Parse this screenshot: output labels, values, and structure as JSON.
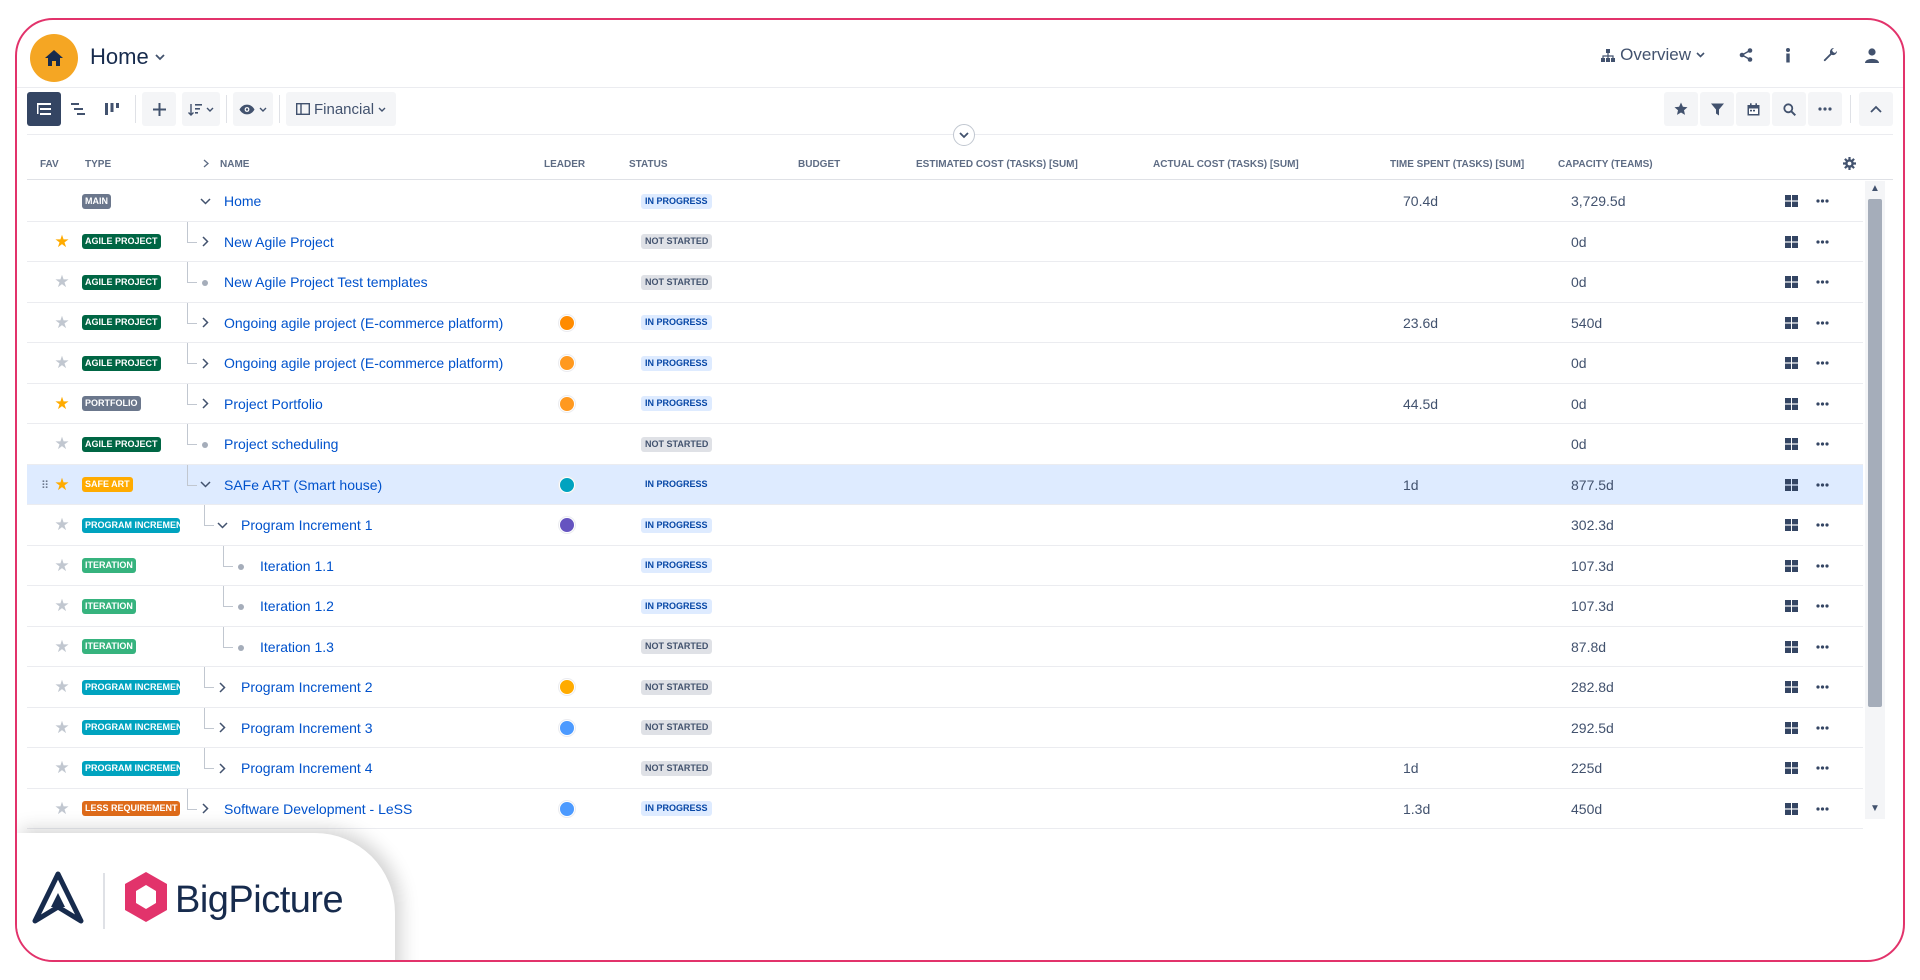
{
  "header": {
    "title": "Home",
    "view_label": "Overview"
  },
  "toolbar": {
    "view_selector_label": "Financial"
  },
  "columns": {
    "fav": "FAV",
    "type": "TYPE",
    "name": "NAME",
    "leader": "LEADER",
    "status": "STATUS",
    "budget": "BUDGET",
    "estimated_cost": "ESTIMATED COST (TASKS) [SUM]",
    "actual_cost": "ACTUAL COST (TASKS) [SUM]",
    "time_spent": "TIME SPENT (TASKS) [SUM]",
    "capacity": "CAPACITY (TEAMS)"
  },
  "rows": [
    {
      "fav": "none",
      "type": "MAIN",
      "type_color": "#6b778c",
      "name": "Home",
      "leader": "",
      "status": "IN PROGRESS",
      "time_spent": "70.4d",
      "capacity": "3,729.5d"
    },
    {
      "fav": "on",
      "type": "AGILE PROJECT",
      "type_color": "#006644",
      "name": "New Agile Project",
      "leader": "",
      "status": "NOT STARTED",
      "time_spent": "",
      "capacity": "0d"
    },
    {
      "fav": "off",
      "type": "AGILE PROJECT",
      "type_color": "#006644",
      "name": "New Agile Project Test templates",
      "leader": "",
      "status": "NOT STARTED",
      "time_spent": "",
      "capacity": "0d"
    },
    {
      "fav": "off",
      "type": "AGILE PROJECT",
      "type_color": "#006644",
      "name": "Ongoing agile project (E-commerce platform)",
      "leader": "#ff8b00",
      "status": "IN PROGRESS",
      "time_spent": "23.6d",
      "capacity": "540d"
    },
    {
      "fav": "off",
      "type": "AGILE PROJECT",
      "type_color": "#006644",
      "name": "Ongoing agile project (E-commerce platform)",
      "leader": "#ff991f",
      "status": "IN PROGRESS",
      "time_spent": "",
      "capacity": "0d"
    },
    {
      "fav": "on",
      "type": "PORTFOLIO",
      "type_color": "#6b778c",
      "name": "Project Portfolio",
      "leader": "#ff991f",
      "status": "IN PROGRESS",
      "time_spent": "44.5d",
      "capacity": "0d"
    },
    {
      "fav": "off",
      "type": "AGILE PROJECT",
      "type_color": "#006644",
      "name": "Project scheduling",
      "leader": "",
      "status": "NOT STARTED",
      "time_spent": "",
      "capacity": "0d"
    },
    {
      "fav": "on",
      "type": "SAFE ART",
      "type_color": "#ffab00",
      "name": "SAFe ART (Smart house)",
      "leader": "#00a3bf",
      "status": "IN PROGRESS",
      "time_spent": "1d",
      "capacity": "877.5d"
    },
    {
      "fav": "off",
      "type": "PROGRAM INCREMENT",
      "type_color": "#00a3bf",
      "name": "Program Increment 1",
      "leader": "#6554c0",
      "status": "IN PROGRESS",
      "time_spent": "",
      "capacity": "302.3d"
    },
    {
      "fav": "off",
      "type": "ITERATION",
      "type_color": "#36b37e",
      "name": "Iteration 1.1",
      "leader": "",
      "status": "IN PROGRESS",
      "time_spent": "",
      "capacity": "107.3d"
    },
    {
      "fav": "off",
      "type": "ITERATION",
      "type_color": "#36b37e",
      "name": "Iteration 1.2",
      "leader": "",
      "status": "IN PROGRESS",
      "time_spent": "",
      "capacity": "107.3d"
    },
    {
      "fav": "off",
      "type": "ITERATION",
      "type_color": "#36b37e",
      "name": "Iteration 1.3",
      "leader": "",
      "status": "NOT STARTED",
      "time_spent": "",
      "capacity": "87.8d"
    },
    {
      "fav": "off",
      "type": "PROGRAM INCREMENT",
      "type_color": "#00a3bf",
      "name": "Program Increment 2",
      "leader": "#ffab00",
      "status": "NOT STARTED",
      "time_spent": "",
      "capacity": "282.8d"
    },
    {
      "fav": "off",
      "type": "PROGRAM INCREMENT",
      "type_color": "#00a3bf",
      "name": "Program Increment 3",
      "leader": "#4c9aff",
      "status": "NOT STARTED",
      "time_spent": "",
      "capacity": "292.5d"
    },
    {
      "fav": "off",
      "type": "PROGRAM INCREMENT",
      "type_color": "#00a3bf",
      "name": "Program Increment 4",
      "leader": "",
      "status": "NOT STARTED",
      "time_spent": "1d",
      "capacity": "225d"
    },
    {
      "fav": "off",
      "type": "LESS REQUIREMENT",
      "type_color": "#de6b1a",
      "name": "Software Development - LeSS",
      "leader": "#4c9aff",
      "status": "IN PROGRESS",
      "time_spent": "1.3d",
      "capacity": "450d"
    }
  ],
  "branding": {
    "product_name": "BigPicture",
    "frame_color": "#e2336b",
    "home_color": "#f5a623"
  },
  "icons": [
    "home-icon",
    "chevron-down-icon",
    "hierarchy-icon",
    "share-icon",
    "info-icon",
    "wrench-icon",
    "user-icon",
    "wbs-icon",
    "gantt-icon",
    "board-icon",
    "plus-icon",
    "sort-icon",
    "eye-icon",
    "columns-icon",
    "star-icon",
    "filter-icon",
    "calendar-icon",
    "search-icon",
    "more-icon",
    "chevron-up-icon",
    "gear-icon",
    "grid-icon",
    "drag-handle-icon"
  ]
}
